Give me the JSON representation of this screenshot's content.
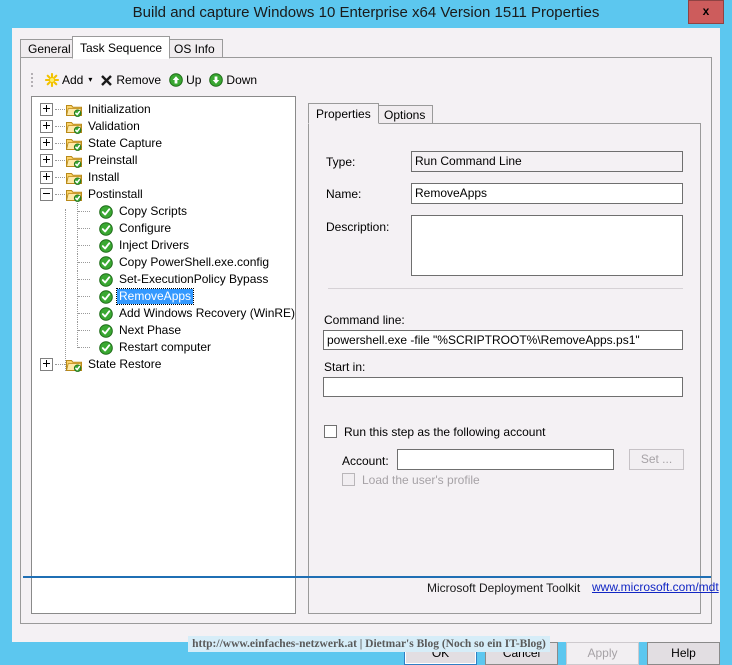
{
  "window": {
    "title": "Build and capture Windows 10 Enterprise x64 Version 1511 Properties",
    "close_label": "x",
    "titlebar_color": "#5cc7ef",
    "close_color": "#cd5c5c"
  },
  "tabs": [
    {
      "label": "General",
      "active": false
    },
    {
      "label": "Task Sequence",
      "active": true
    },
    {
      "label": "OS Info",
      "active": false
    }
  ],
  "toolbar": {
    "add_label": "Add",
    "add_caret": "▾",
    "remove_label": "Remove",
    "up_label": "Up",
    "down_label": "Down"
  },
  "tree": {
    "items": [
      {
        "label": "Initialization",
        "level": 0,
        "icon": "folder-check-icon",
        "expander": "plus",
        "selected": false
      },
      {
        "label": "Validation",
        "level": 0,
        "icon": "folder-check-icon",
        "expander": "plus",
        "selected": false
      },
      {
        "label": "State Capture",
        "level": 0,
        "icon": "folder-check-icon",
        "expander": "plus",
        "selected": false
      },
      {
        "label": "Preinstall",
        "level": 0,
        "icon": "folder-check-icon",
        "expander": "plus",
        "selected": false
      },
      {
        "label": "Install",
        "level": 0,
        "icon": "folder-check-icon",
        "expander": "plus",
        "selected": false
      },
      {
        "label": "Postinstall",
        "level": 0,
        "icon": "folder-check-icon",
        "expander": "minus",
        "selected": false
      },
      {
        "label": "Copy Scripts",
        "level": 1,
        "icon": "green-check-icon",
        "expander": "none",
        "selected": false
      },
      {
        "label": "Configure",
        "level": 1,
        "icon": "green-check-icon",
        "expander": "none",
        "selected": false
      },
      {
        "label": "Inject Drivers",
        "level": 1,
        "icon": "green-check-icon",
        "expander": "none",
        "selected": false
      },
      {
        "label": "Copy PowerShell.exe.config",
        "level": 1,
        "icon": "green-check-icon",
        "expander": "none",
        "selected": false
      },
      {
        "label": "Set-ExecutionPolicy Bypass",
        "level": 1,
        "icon": "green-check-icon",
        "expander": "none",
        "selected": false
      },
      {
        "label": "RemoveApps",
        "level": 1,
        "icon": "green-check-icon",
        "expander": "none",
        "selected": true
      },
      {
        "label": "Add Windows Recovery (WinRE)",
        "level": 1,
        "icon": "green-check-icon",
        "expander": "none",
        "selected": false
      },
      {
        "label": "Next Phase",
        "level": 1,
        "icon": "green-check-icon",
        "expander": "none",
        "selected": false
      },
      {
        "label": "Restart computer",
        "level": 1,
        "icon": "green-check-icon",
        "expander": "none",
        "selected": false
      },
      {
        "label": "State Restore",
        "level": 0,
        "icon": "folder-check-icon",
        "expander": "plus",
        "selected": false
      }
    ]
  },
  "inner_tabs": [
    {
      "label": "Properties",
      "active": true
    },
    {
      "label": "Options",
      "active": false
    }
  ],
  "properties": {
    "type_label": "Type:",
    "type_value": "Run Command Line",
    "name_label": "Name:",
    "name_value": "RemoveApps",
    "description_label": "Description:",
    "description_value": "",
    "command_line_label": "Command line:",
    "command_line_value": "powershell.exe -file \"%SCRIPTROOT%\\RemoveApps.ps1\"",
    "start_in_label": "Start in:",
    "start_in_value": "",
    "run_as_label": "Run this step as the following account",
    "run_as_checked": false,
    "account_label": "Account:",
    "account_value": "",
    "set_button_label": "Set ...",
    "load_profile_label": "Load the user's profile",
    "load_profile_checked": false
  },
  "mdt_footer": {
    "text": "Microsoft Deployment Toolkit",
    "link": "www.microsoft.com/mdt",
    "rule_color": "#1f6fb4",
    "link_color": "#1126c4"
  },
  "dialog_buttons": [
    {
      "label": "OK",
      "state": "focused"
    },
    {
      "label": "Cancel",
      "state": "normal"
    },
    {
      "label": "Apply",
      "state": "disabled"
    },
    {
      "label": "Help",
      "state": "normal"
    }
  ],
  "watermark": {
    "text": "http://www.einfaches-netzwerk.at | Dietmar's Blog (Noch so ein IT-Blog)"
  }
}
